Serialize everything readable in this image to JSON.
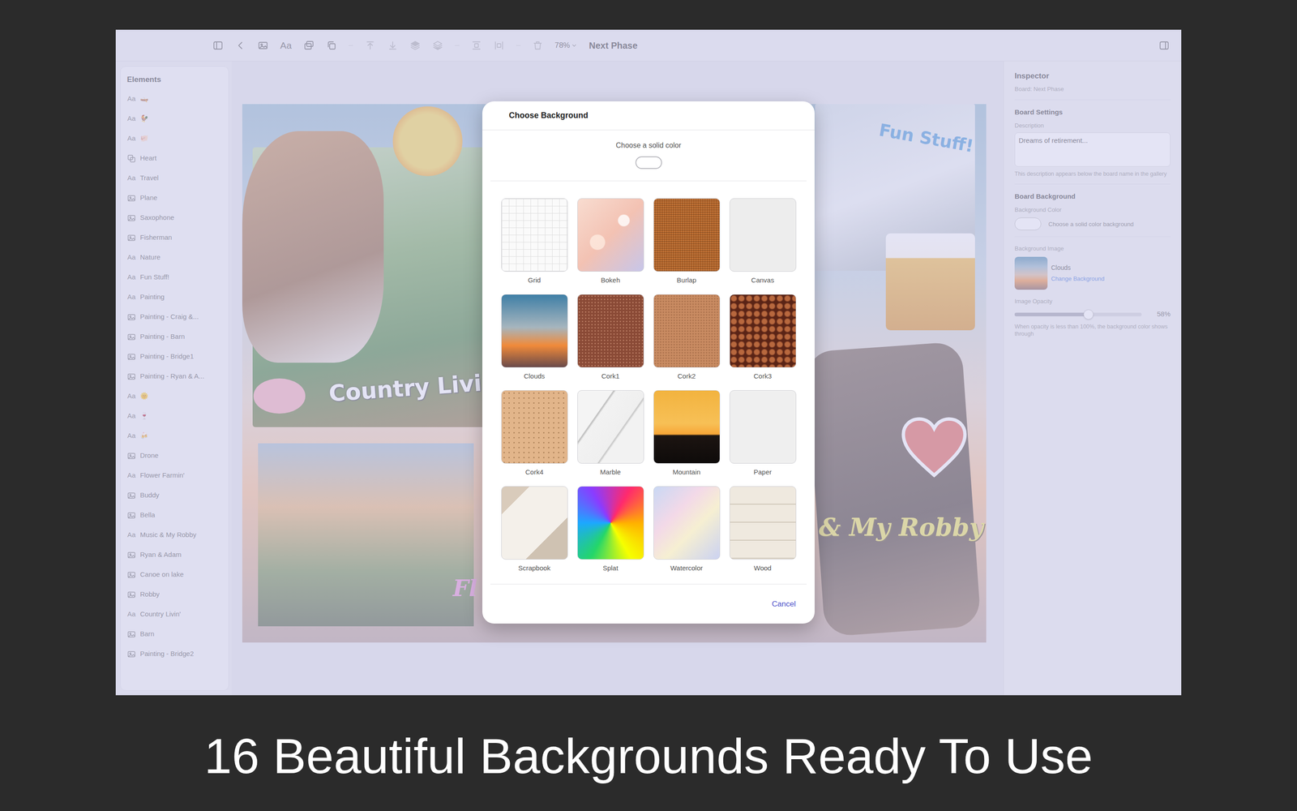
{
  "toolbar": {
    "text_tool": "Aa",
    "zoom": "78%",
    "board_title": "Next Phase",
    "edit_tools_disabled": true
  },
  "sidebar": {
    "title": "Elements",
    "items": [
      {
        "kind": "text",
        "glyph": "Aa",
        "label": "🛶"
      },
      {
        "kind": "text",
        "glyph": "Aa",
        "label": "🐓"
      },
      {
        "kind": "text",
        "glyph": "Aa",
        "label": "🐖"
      },
      {
        "kind": "shape",
        "label": "Heart"
      },
      {
        "kind": "text",
        "glyph": "Aa",
        "label": "Travel"
      },
      {
        "kind": "image",
        "label": "Plane"
      },
      {
        "kind": "image",
        "label": "Saxophone"
      },
      {
        "kind": "image",
        "label": "Fisherman"
      },
      {
        "kind": "text",
        "glyph": "Aa",
        "label": "Nature"
      },
      {
        "kind": "text",
        "glyph": "Aa",
        "label": "Fun Stuff!"
      },
      {
        "kind": "text",
        "glyph": "Aa",
        "label": "Painting"
      },
      {
        "kind": "image",
        "label": "Painting - Craig &..."
      },
      {
        "kind": "image",
        "label": "Painting - Barn"
      },
      {
        "kind": "image",
        "label": "Painting - Bridge1"
      },
      {
        "kind": "image",
        "label": "Painting - Ryan & A..."
      },
      {
        "kind": "text",
        "glyph": "Aa",
        "label": "🌞"
      },
      {
        "kind": "text",
        "glyph": "Aa",
        "label": "🍷"
      },
      {
        "kind": "text",
        "glyph": "Aa",
        "label": "🍻"
      },
      {
        "kind": "image",
        "label": "Drone"
      },
      {
        "kind": "text",
        "glyph": "Aa",
        "label": "Flower Farmin'"
      },
      {
        "kind": "image",
        "label": "Buddy"
      },
      {
        "kind": "image",
        "label": "Bella"
      },
      {
        "kind": "text",
        "glyph": "Aa",
        "label": "Music & My Robby"
      },
      {
        "kind": "image",
        "label": "Ryan & Adam"
      },
      {
        "kind": "image",
        "label": "Canoe on lake"
      },
      {
        "kind": "image",
        "label": "Robby"
      },
      {
        "kind": "text",
        "glyph": "Aa",
        "label": "Country Livin'"
      },
      {
        "kind": "image",
        "label": "Barn"
      },
      {
        "kind": "image",
        "label": "Painting - Bridge2"
      }
    ]
  },
  "canvas": {
    "country_text": "Country Livi",
    "fun_text": "Fun Stuff!",
    "robby_text": "& My Robby",
    "flower_text": "Fl"
  },
  "inspector": {
    "title": "Inspector",
    "board_line": "Board: Next Phase",
    "settings_heading": "Board Settings",
    "description_label": "Description",
    "description_value": "Dreams of retirement...",
    "description_help": "This description appears below the board name in the gallery",
    "background_heading": "Board Background",
    "color_label": "Background Color",
    "color_hint": "Choose a solid color background",
    "image_label": "Background Image",
    "image_name": "Clouds",
    "change_link": "Change Background",
    "opacity_label": "Image Opacity",
    "opacity_level": 0.58,
    "opacity_reading": "58%",
    "opacity_help": "When opacity is less than 100%, the background color shows through"
  },
  "dialog": {
    "title": "Choose Background",
    "solid_color_label": "Choose a solid color",
    "backgrounds": [
      {
        "name": "Grid"
      },
      {
        "name": "Bokeh"
      },
      {
        "name": "Burlap"
      },
      {
        "name": "Canvas"
      },
      {
        "name": "Clouds"
      },
      {
        "name": "Cork1"
      },
      {
        "name": "Cork2"
      },
      {
        "name": "Cork3"
      },
      {
        "name": "Cork4"
      },
      {
        "name": "Marble"
      },
      {
        "name": "Mountain"
      },
      {
        "name": "Paper"
      },
      {
        "name": "Scrapbook"
      },
      {
        "name": "Splat"
      },
      {
        "name": "Watercolor"
      },
      {
        "name": "Wood"
      }
    ],
    "cancel": "Cancel"
  },
  "caption": "16 Beautiful Backgrounds Ready To Use"
}
